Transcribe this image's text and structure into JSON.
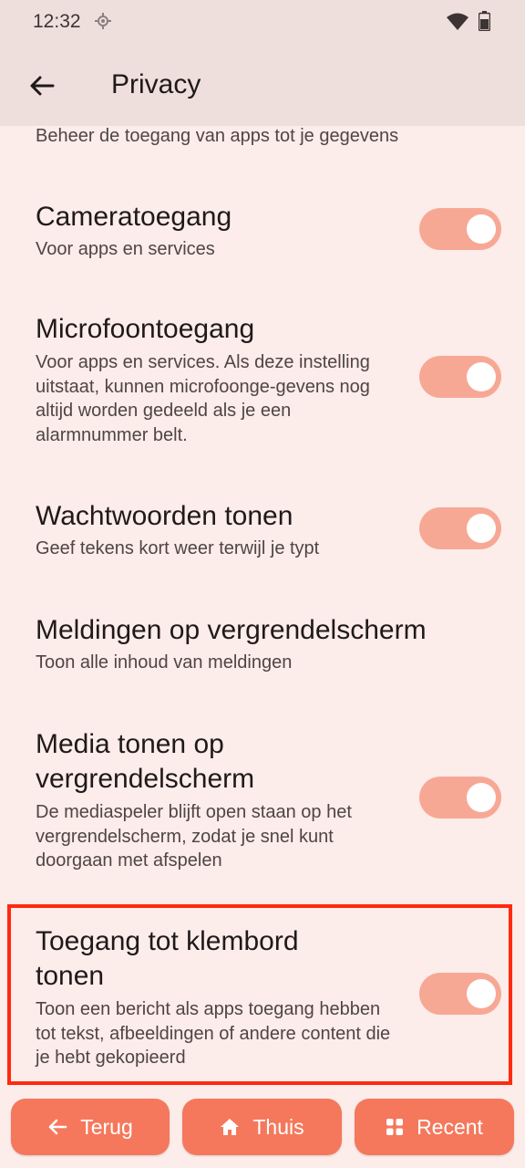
{
  "status": {
    "time": "12:32"
  },
  "appbar": {
    "title": "Privacy"
  },
  "partial_subtitle": "Beheer de toegang van apps tot je gegevens",
  "items": [
    {
      "title": "Cameratoegang",
      "subtitle": "Voor apps en services",
      "toggle": "on"
    },
    {
      "title": "Microfoontoegang",
      "subtitle": "Voor apps en services. Als deze instelling uitstaat, kunnen microfoonge-gevens nog altijd worden gedeeld als je een alarmnummer belt.",
      "toggle": "on"
    },
    {
      "title": "Wachtwoorden tonen",
      "subtitle": "Geef tekens kort weer terwijl je typt",
      "toggle": "on"
    },
    {
      "title": "Meldingen op vergrendelscherm",
      "subtitle": "Toon alle inhoud van meldingen"
    },
    {
      "title": "Media tonen op vergrendelscherm",
      "subtitle": "De mediaspeler blijft open staan op het vergrendelscherm, zodat je snel kunt doorgaan met afspelen",
      "toggle": "on"
    },
    {
      "title": "Toegang tot klembord tonen",
      "subtitle": "Toon een bericht als apps toegang hebben tot tekst, afbeeldingen of andere content die je hebt gekopieerd",
      "toggle": "on"
    }
  ],
  "nav": {
    "back": "Terug",
    "home": "Thuis",
    "recent": "Recent"
  },
  "colors": {
    "accent": "#f5785c",
    "toggle_track": "#f7a895",
    "highlight": "#ff2a0f",
    "background": "#fcecea"
  }
}
